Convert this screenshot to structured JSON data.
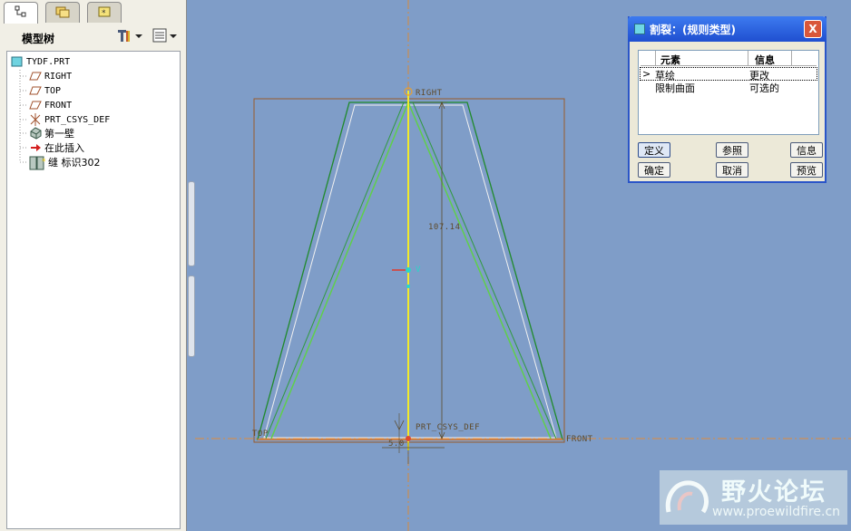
{
  "left_panel": {
    "tabs": [
      {
        "icon": "model-tree-tab-icon"
      },
      {
        "icon": "folder-browser-tab-icon"
      },
      {
        "icon": "favorites-tab-icon"
      }
    ],
    "title": "模型树",
    "settings_icon": "tools-icon",
    "show_icon": "list-icon"
  },
  "tree": {
    "items": [
      {
        "label": "TYDF.PRT",
        "icon": "part-icon"
      },
      {
        "label": "RIGHT",
        "icon": "datum-plane-icon"
      },
      {
        "label": "TOP",
        "icon": "datum-plane-icon"
      },
      {
        "label": "FRONT",
        "icon": "datum-plane-icon"
      },
      {
        "label": "PRT_CSYS_DEF",
        "icon": "csys-icon"
      },
      {
        "label": "第一壁",
        "icon": "sheetmetal-wall-icon"
      },
      {
        "label": "在此插入",
        "icon": "insert-arrow-icon"
      },
      {
        "label": "缝 标识302",
        "icon": "rip-feature-icon"
      }
    ]
  },
  "canvas": {
    "labels": {
      "right": "RIGHT",
      "top": "TOP",
      "front": "FRONT",
      "csys": "PRT_CSYS_DEF",
      "dim_height": "107.14",
      "dim_width": "5.0",
      "v_marker": "V"
    },
    "colors": {
      "background": "#7f9dc8",
      "datum": "#d98a3a",
      "geometry": "#2f9a3f",
      "axis": "#e8e02a"
    }
  },
  "dialog": {
    "title": "割裂：(规则类型)",
    "columns": [
      "元素",
      "信息"
    ],
    "rows": [
      {
        "marker": ">",
        "element": "草绘",
        "info": "更改"
      },
      {
        "marker": "",
        "element": "限制曲面",
        "info": "可选的"
      }
    ],
    "buttons": {
      "define": "定义",
      "refs": "参照",
      "info": "信息",
      "ok": "确定",
      "cancel": "取消",
      "preview": "预览"
    },
    "close": "X"
  },
  "watermark": {
    "title": "野火论坛",
    "url": "www.proewildfire.cn"
  }
}
